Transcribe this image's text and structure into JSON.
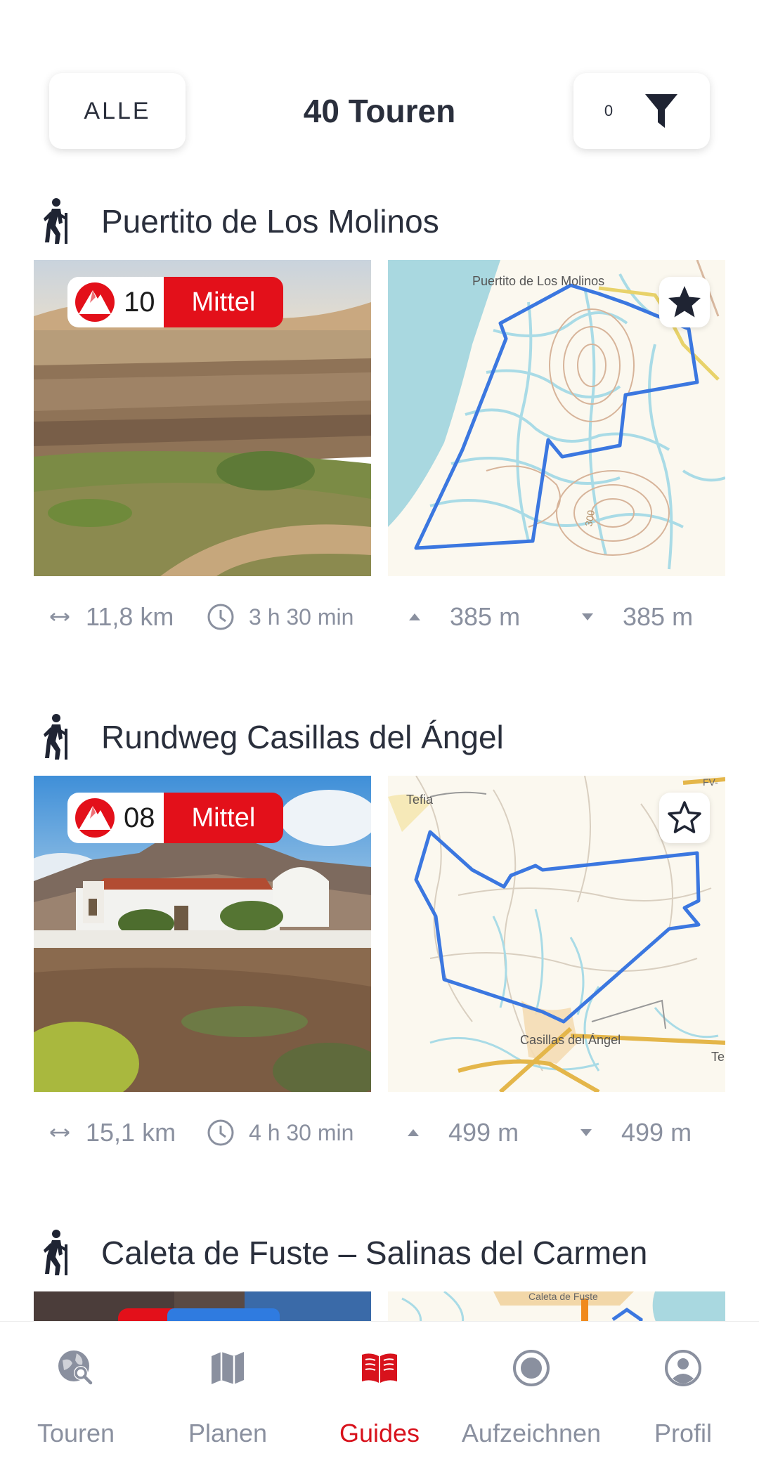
{
  "header": {
    "all_label": "ALLE",
    "title": "40 Touren",
    "filter_count": "0"
  },
  "tours": [
    {
      "name": "Puertito de Los Molinos",
      "rating": "10",
      "difficulty": "Mittel",
      "favorite": true,
      "map_label": "Puertito de Los Molinos",
      "map_contour_label": "300",
      "distance": "11,8 km",
      "duration": "3 h 30 min",
      "ascent": "385 m",
      "descent": "385 m"
    },
    {
      "name": "Rundweg Casillas del Ángel",
      "rating": "08",
      "difficulty": "Mittel",
      "favorite": false,
      "map_labels": [
        "Tefia",
        "Casillas del Ángel",
        "FV-",
        "Te"
      ],
      "distance": "15,1 km",
      "duration": "4 h 30 min",
      "ascent": "499 m",
      "descent": "499 m"
    },
    {
      "name": "Caleta de Fuste – Salinas del Carmen",
      "map_label": "Caleta de Fuste"
    }
  ],
  "nav": {
    "items": [
      {
        "label": "Touren",
        "icon": "globe-search-icon",
        "active": false
      },
      {
        "label": "Planen",
        "icon": "map-icon",
        "active": false
      },
      {
        "label": "Guides",
        "icon": "book-icon",
        "active": true
      },
      {
        "label": "Aufzeichnen",
        "icon": "record-icon",
        "active": false
      },
      {
        "label": "Profil",
        "icon": "profile-icon",
        "active": false
      }
    ]
  },
  "colors": {
    "accent_red": "#e3101a",
    "nav_active": "#d8121c",
    "text_dark": "#2a2f3c",
    "text_muted": "#8a909f",
    "route_blue": "#3b77e0"
  }
}
